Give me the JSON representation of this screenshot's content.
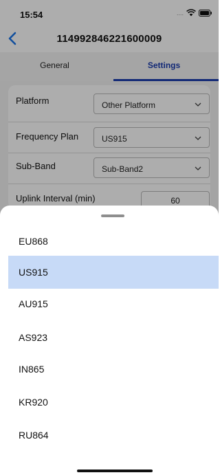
{
  "status_bar": {
    "time": "15:54",
    "signal_dots": "....",
    "icons": [
      "wifi-icon",
      "battery-icon"
    ]
  },
  "nav": {
    "back_icon": "chevron-left-icon",
    "title": "114992846221600009"
  },
  "tabs": [
    {
      "label": "General",
      "active": false
    },
    {
      "label": "Settings",
      "active": true
    }
  ],
  "settings": {
    "platform": {
      "label": "Platform",
      "value": "Other Platform"
    },
    "frequency_plan": {
      "label": "Frequency Plan",
      "value": "US915"
    },
    "sub_band": {
      "label": "Sub-Band",
      "value": "Sub-Band2"
    },
    "uplink_interval": {
      "label": "Uplink Interval (min)",
      "value": "60"
    }
  },
  "picker": {
    "options": [
      "EU868",
      "US915",
      "AU915",
      "AS923",
      "IN865",
      "KR920",
      "RU864"
    ],
    "selected": "US915"
  },
  "colors": {
    "accent": "#1a3cae",
    "selected_row": "#c7daf7",
    "back_chevron": "#1a73e8"
  }
}
